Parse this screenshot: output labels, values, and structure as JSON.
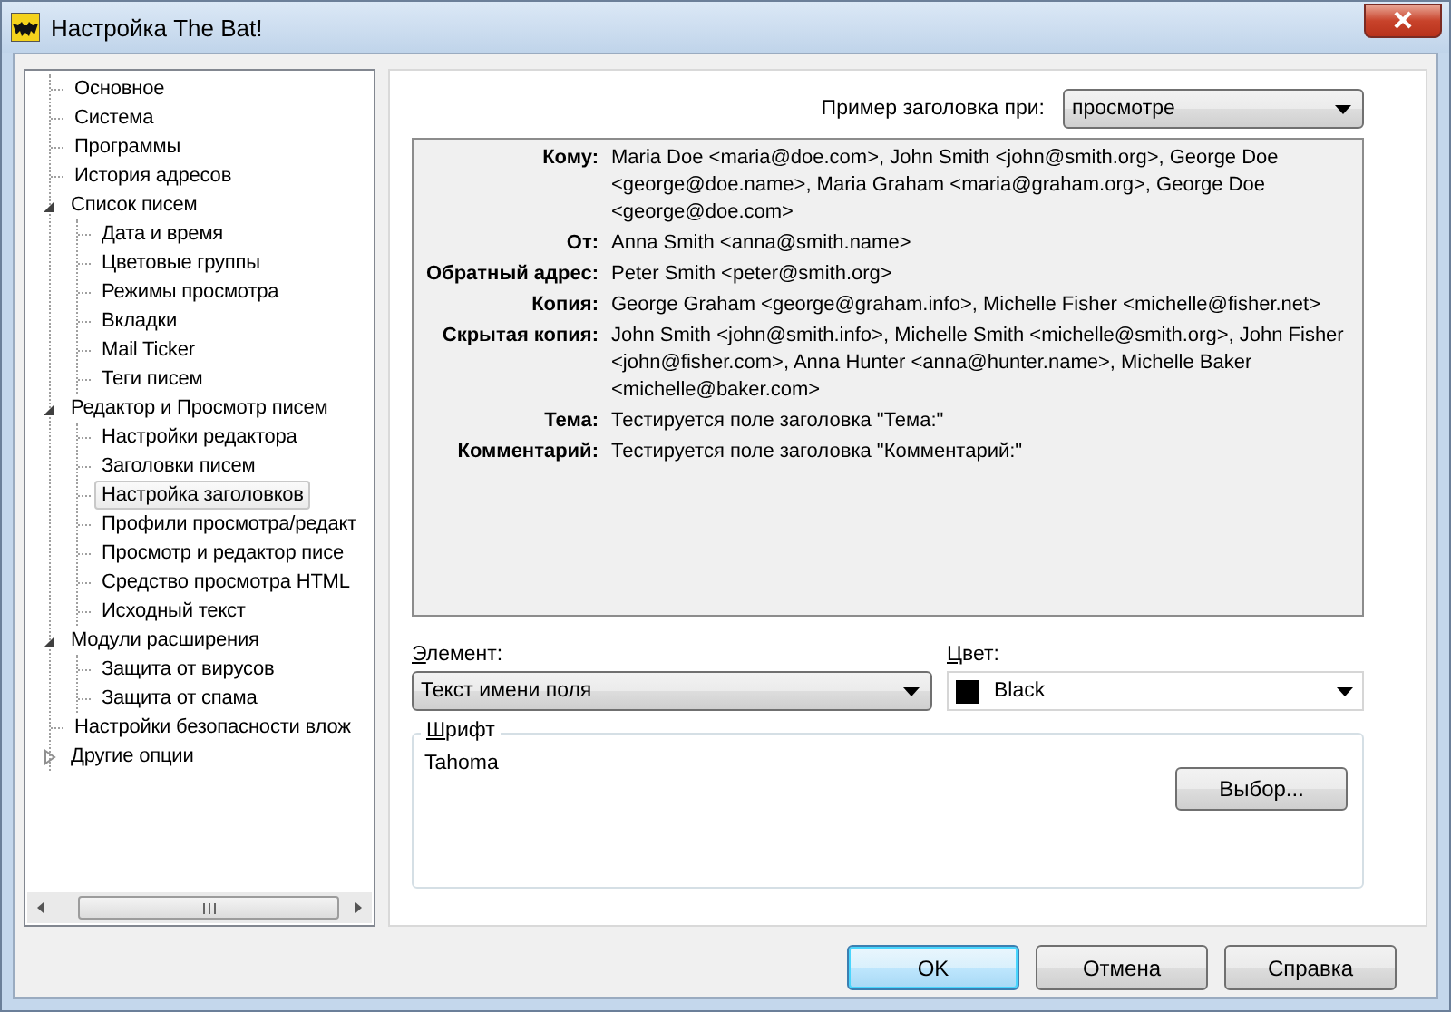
{
  "window": {
    "title": "Настройка The Bat!"
  },
  "tree": {
    "items": [
      {
        "label": "Основное",
        "selected": false
      },
      {
        "label": "Система",
        "selected": false
      },
      {
        "label": "Программы",
        "selected": false
      },
      {
        "label": "История адресов",
        "selected": false
      },
      {
        "label": "Список писем",
        "selected": false,
        "expanded": true,
        "children": [
          {
            "label": "Дата и время",
            "selected": false
          },
          {
            "label": "Цветовые группы",
            "selected": false
          },
          {
            "label": "Режимы просмотра",
            "selected": false
          },
          {
            "label": "Вкладки",
            "selected": false
          },
          {
            "label": "Mail Ticker",
            "selected": false
          },
          {
            "label": "Теги писем",
            "selected": false
          }
        ]
      },
      {
        "label": "Редактор и Просмотр писем",
        "selected": false,
        "expanded": true,
        "children": [
          {
            "label": "Настройки редактора",
            "selected": false
          },
          {
            "label": "Заголовки писем",
            "selected": false
          },
          {
            "label": "Настройка заголовков",
            "selected": true
          },
          {
            "label": "Профили просмотра/редакт",
            "selected": false
          },
          {
            "label": "Просмотр и редактор писе",
            "selected": false
          },
          {
            "label": "Средство просмотра HTML",
            "selected": false
          },
          {
            "label": "Исходный текст",
            "selected": false
          }
        ]
      },
      {
        "label": "Модули расширения",
        "selected": false,
        "expanded": true,
        "children": [
          {
            "label": "Защита от вирусов",
            "selected": false
          },
          {
            "label": "Защита от спама",
            "selected": false
          }
        ]
      },
      {
        "label": "Настройки безопасности влож",
        "selected": false
      },
      {
        "label": "Другие опции",
        "selected": false,
        "expanded": false
      }
    ]
  },
  "preview": {
    "label": "Пример заголовка при:",
    "mode": "просмотре",
    "fields": [
      {
        "name": "Кому:",
        "value": "Maria Doe <maria@doe.com>, John Smith <john@smith.org>, George Doe <george@doe.name>, Maria Graham <maria@graham.org>, George Doe <george@doe.com>"
      },
      {
        "name": "От:",
        "value": "Anna Smith <anna@smith.name>"
      },
      {
        "name": "Обратный адрес:",
        "value": "Peter Smith <peter@smith.org>"
      },
      {
        "name": "Копия:",
        "value": "George Graham <george@graham.info>, Michelle Fisher <michelle@fisher.net>"
      },
      {
        "name": "Скрытая копия:",
        "value": "John Smith <john@smith.info>, Michelle Smith <michelle@smith.org>, John Fisher <john@fisher.com>, Anna Hunter <anna@hunter.name>, Michelle Baker <michelle@baker.com>"
      },
      {
        "name": "Тема:",
        "value": "Тестируется поле заголовка \"Тема:\""
      },
      {
        "name": "Комментарий:",
        "value": "Тестируется поле заголовка \"Комментарий:\""
      }
    ]
  },
  "element": {
    "label": "Элемент:",
    "mnemonic": true,
    "value": "Текст имени поля"
  },
  "color": {
    "label": "Цвет:",
    "mnemonic": true,
    "value": "Black"
  },
  "font_group": {
    "label": "Шрифт",
    "mnemonic": true,
    "value": "Tahoma",
    "button": "Выбор..."
  },
  "buttons": [
    {
      "label": "OK",
      "default": true
    },
    {
      "label": "Отмена",
      "default": false
    },
    {
      "label": "Справка",
      "default": false
    }
  ]
}
